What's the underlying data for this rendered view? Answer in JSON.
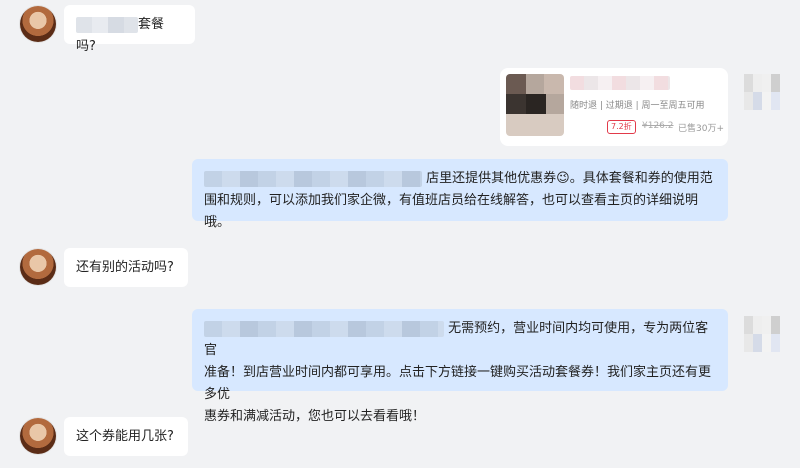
{
  "messages": [
    {
      "suffix": "套餐吗?"
    },
    {
      "card_sub": "随时退 | 过期退 | 周一至周五可用",
      "card_discount": "7.2折",
      "card_price": "¥126.2",
      "card_sold": "已售30万+"
    },
    {
      "line1": "店里还提供其他优惠券😉。具体套餐和券的使用范",
      "line2": "围和规则，可以添加我们家企微，有值班店员给在线解答，也可以查看主页的详细说明哦。"
    },
    {
      "text": "还有别的活动吗?"
    },
    {
      "line1": "无需预约，营业时间内均可使用，专为两位客官",
      "line2": "准备！到店营业时间内都可享用。点击下方链接一键购买活动套餐券！我们家主页还有更多优",
      "line3": "惠券和满减活动，您也可以去看看哦！"
    },
    {
      "text": "这个券能用几张?"
    }
  ]
}
